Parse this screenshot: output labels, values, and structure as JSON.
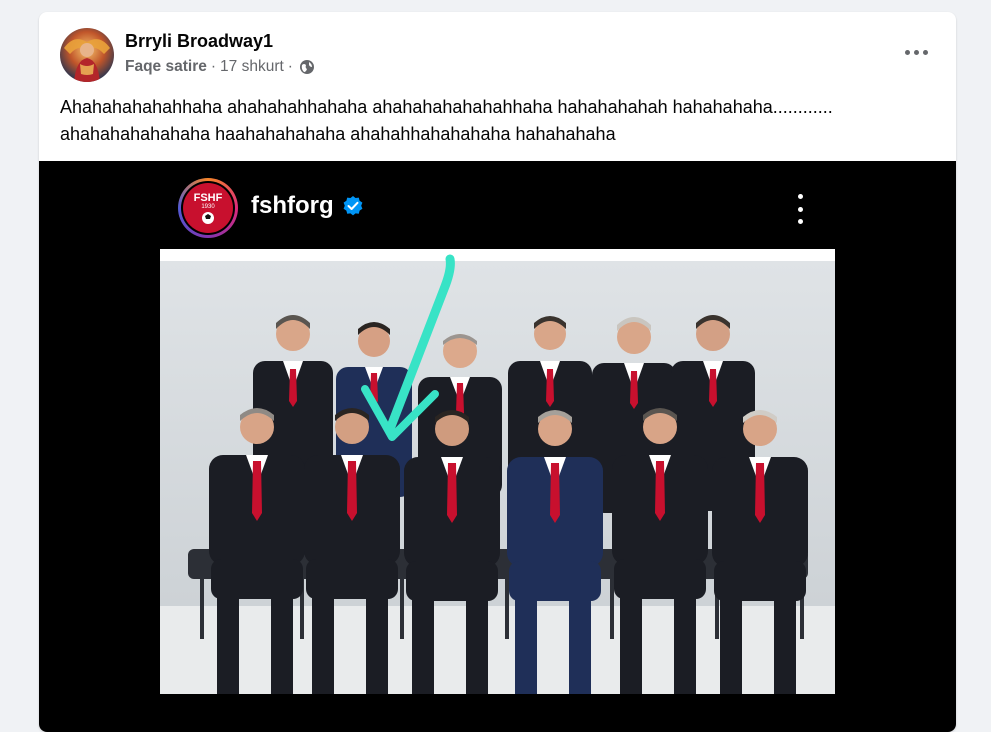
{
  "post": {
    "author": "Brryli Broadway1",
    "page_type": "Faqe satire",
    "separator": "·",
    "date": "17 shkurt",
    "separator2": "·",
    "privacy_icon": "globe-icon",
    "more_icon": "more-options-icon",
    "text_line1": "Ahahahahahahhaha ahahahahhahaha ahahahahahahahhaha hahahahahah hahahahaha............",
    "text_line2": "ahahahahahahaha haahahahahaha ahahahhahahahaha hahahahaha"
  },
  "embedded": {
    "account": "fshforg",
    "logo_text_top": "FSHF",
    "logo_text_year": "1930",
    "verified_icon": "verified-badge-icon",
    "more_icon": "vertical-more-icon",
    "brand_color": "#c8102e",
    "annotation_color": "#38e3c6"
  },
  "colors": {
    "background": "#f0f2f5",
    "card": "#ffffff",
    "secondary_text": "#65676b"
  }
}
